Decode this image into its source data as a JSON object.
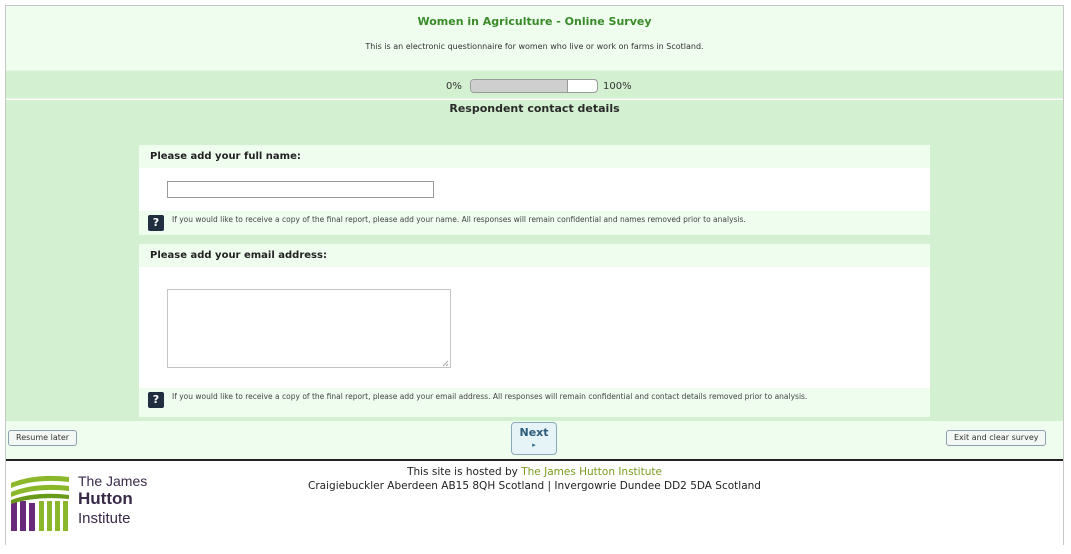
{
  "header": {
    "title": "Women in Agriculture - Online Survey",
    "description": "This is an electronic questionnaire for women who live or work on farms in Scotland."
  },
  "progress": {
    "min_label": "0%",
    "max_label": "100%",
    "value_fraction": 0.77
  },
  "section": {
    "title": "Respondent contact details"
  },
  "questions": [
    {
      "label": "Please add your full name:",
      "input_value": "",
      "help_icon": "question-mark-icon",
      "help_glyph": "?",
      "help_text": "If you would like to receive a copy of the final report, please add your name. All responses will remain confidential and names removed prior to analysis."
    },
    {
      "label": "Please add your email address:",
      "input_value": "",
      "help_icon": "question-mark-icon",
      "help_glyph": "?",
      "help_text": "If you would like to receive a copy of the final report, please add your email address. All responses will remain confidential and contact details removed prior to analysis."
    }
  ],
  "nav": {
    "resume_label": "Resume later",
    "next_label": "Next",
    "next_arrow": "▸",
    "exit_label": "Exit and clear survey"
  },
  "footer": {
    "hosted_prefix": "This site is hosted by ",
    "host_name": "The James Hutton Institute",
    "address": "Craigiebuckler Aberdeen AB15 8QH Scotland | Invergowrie Dundee DD2 5DA Scotland",
    "logo_lines": [
      "The James",
      "Hutton",
      "Institute"
    ]
  },
  "colors": {
    "accent_green": "#3a8a2a",
    "panel_green": "#d3f0d0",
    "light_green": "#eefded",
    "logo_purple": "#6a2a7a",
    "logo_green": "#8ab82a"
  }
}
